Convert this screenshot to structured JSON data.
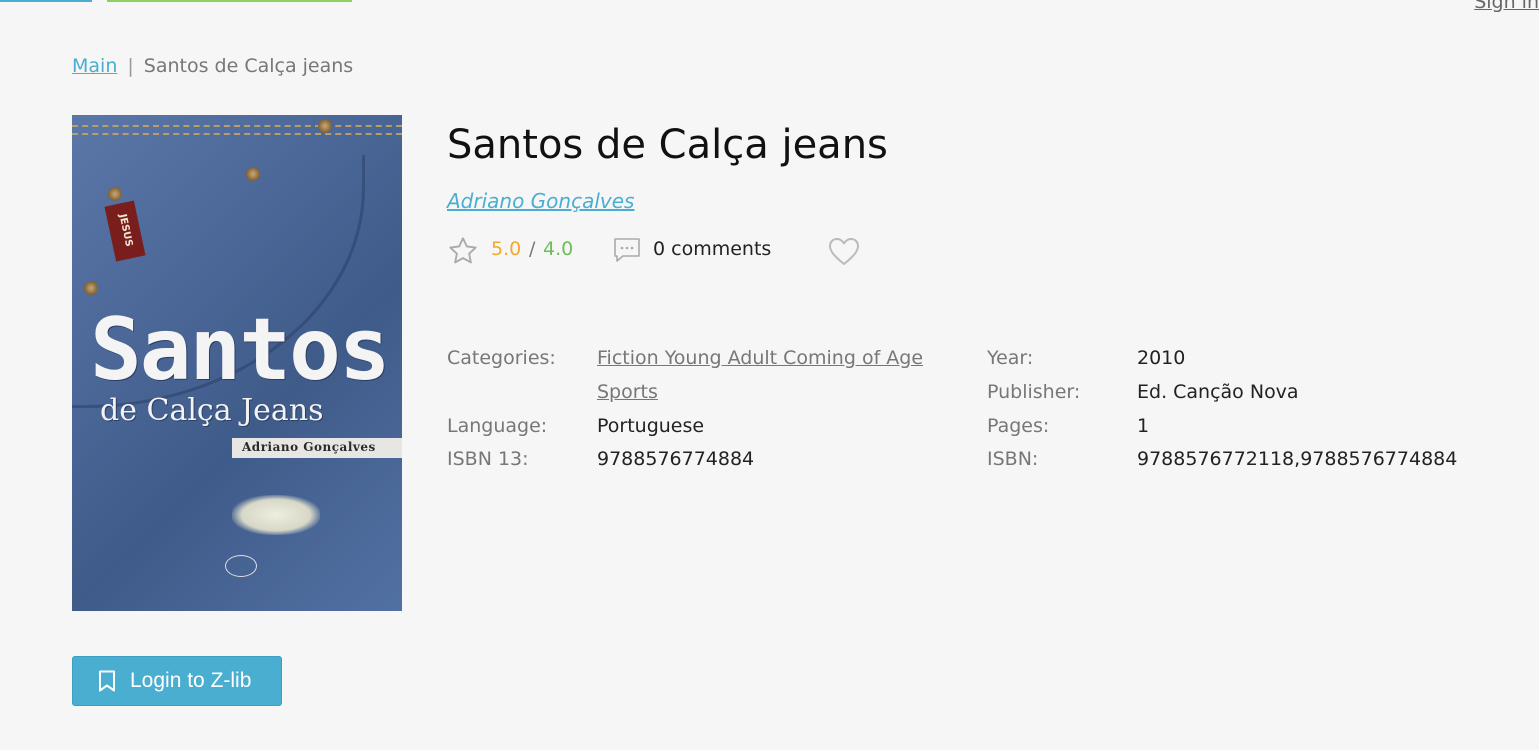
{
  "header": {
    "signin_label": "Sign in"
  },
  "breadcrumb": {
    "home_label": "Main",
    "separator": "|",
    "current": "Santos de Calça jeans"
  },
  "book": {
    "title": "Santos de Calça jeans",
    "author": "Adriano Gonçalves",
    "cover": {
      "tag_text": "JESUS",
      "title_line1": "Santos",
      "title_line2": "de Calça Jeans",
      "author_line": "Adriano Gonçalves"
    },
    "rating_a": "5.0",
    "rating_separator": "/",
    "rating_b": "4.0",
    "comments_label": "0 comments"
  },
  "details": {
    "categories_label": "Categories:",
    "categories": [
      "Fiction Young Adult Coming of Age",
      "Sports"
    ],
    "language_label": "Language:",
    "language": "Portuguese",
    "isbn13_label": "ISBN 13:",
    "isbn13": "9788576774884",
    "year_label": "Year:",
    "year": "2010",
    "publisher_label": "Publisher:",
    "publisher": "Ed. Canção Nova",
    "pages_label": "Pages:",
    "pages": "1",
    "isbn_label": "ISBN:",
    "isbn": "9788576772118,9788576774884"
  },
  "actions": {
    "login_label": "Login to Z-lib"
  },
  "icons": {
    "star": "star-outline-icon",
    "comment": "comment-bubble-icon",
    "heart": "heart-outline-icon",
    "bookmark": "bookmark-icon"
  },
  "colors": {
    "accent": "#49aed0",
    "rating_orange": "#f0a92e",
    "rating_green": "#6bbe55",
    "label_gray": "#777777",
    "top_tab_green": "#8ed15e"
  }
}
